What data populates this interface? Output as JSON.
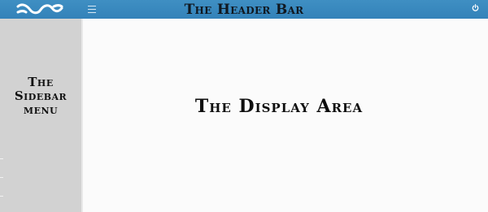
{
  "header": {
    "title": "The Header Bar",
    "logo_icon": "logo-icon",
    "menu_icon": "hamburger-menu-icon",
    "power_icon": "power-icon",
    "background_color": "#3a89c0"
  },
  "sidebar": {
    "label_lines": [
      "The",
      "Sidebar",
      "menu"
    ],
    "background_color": "#d2d2d2"
  },
  "main": {
    "title": "The Display Area",
    "background_color": "#fbfbfb"
  }
}
